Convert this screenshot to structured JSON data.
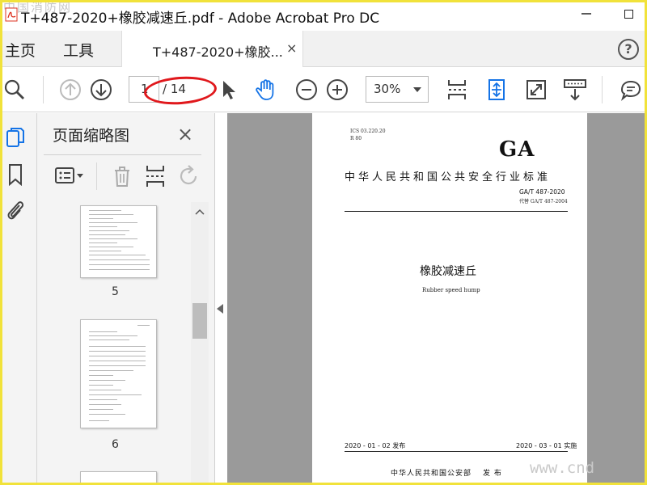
{
  "window": {
    "title": "T+487-2020+橡胶减速丘.pdf - Adobe Acrobat Pro DC",
    "watermark_top": "中国消防网",
    "watermark_bottom": "www.cnd"
  },
  "tabs": {
    "home": "主页",
    "tools": "工具",
    "document": "T+487-2020+橡胶...",
    "close": "×",
    "help": "?"
  },
  "toolbar": {
    "current_page": "1",
    "total_pages": "/ 14",
    "zoom": "30%",
    "icons": [
      "search-icon",
      "previous-page-icon",
      "next-page-icon",
      "select-cursor-icon",
      "hand-tool-icon",
      "zoom-out-icon",
      "zoom-in-icon",
      "fit-page-icon",
      "rotate-page-icon",
      "full-screen-icon",
      "scroll-mode-icon",
      "comment-icon"
    ],
    "highlight_color": "#e0181c"
  },
  "sidebar": {
    "panel_title": "页面缩略图",
    "close": "×",
    "thumbnails": [
      {
        "page": "5"
      },
      {
        "page": "6"
      }
    ]
  },
  "document": {
    "ics": "ICS 03.220.20",
    "category": "R 80",
    "ga": "GA",
    "standard_title": "中华人民共和国公共安全行业标准",
    "standard_no": "GA/T 487-2020",
    "replaces": "代替 GA/T 487-2004",
    "title_cn": "橡胶减速丘",
    "title_en": "Rubber speed hump",
    "publish": "2020 - 01 - 02 发布",
    "implement": "2020 - 03 - 01 实施",
    "issuer": "中华人民共和国公安部",
    "issuer_suffix": "发 布"
  },
  "colors": {
    "accent_blue": "#1473e6",
    "frame_yellow": "#f1e23a"
  }
}
